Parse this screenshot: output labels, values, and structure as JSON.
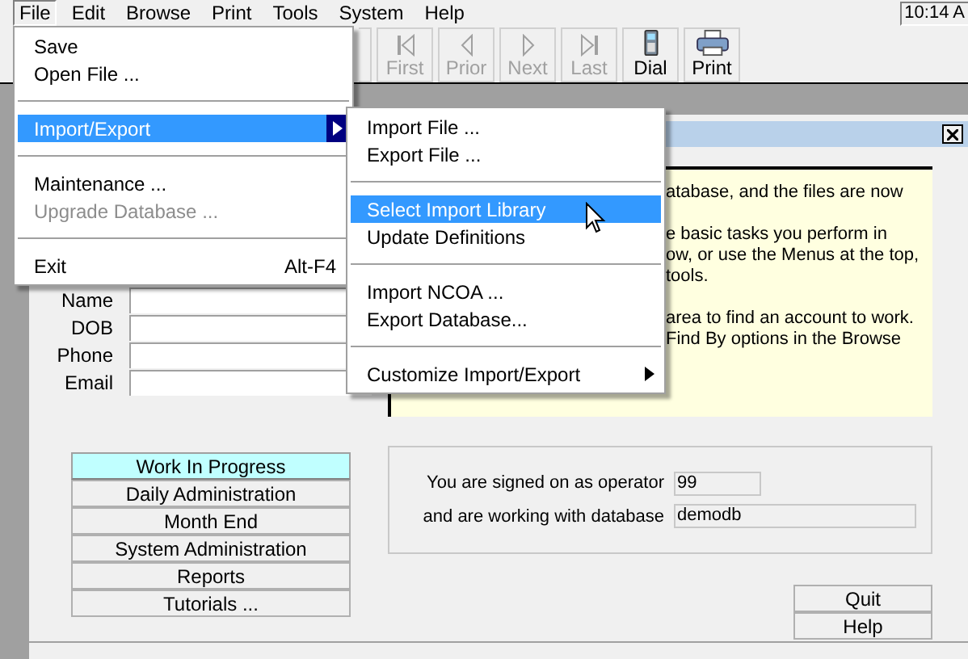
{
  "menu_bar": {
    "items": [
      {
        "label": "File",
        "selected": true
      },
      {
        "label": "Edit",
        "selected": false
      },
      {
        "label": "Browse",
        "selected": false
      },
      {
        "label": "Print",
        "selected": false
      },
      {
        "label": "Tools",
        "selected": false
      },
      {
        "label": "System",
        "selected": false
      },
      {
        "label": "Help",
        "selected": false
      }
    ],
    "clock": "10:14 A"
  },
  "toolbar": [
    {
      "label": "First",
      "disabled": true
    },
    {
      "label": "Prior",
      "disabled": true
    },
    {
      "label": "Next",
      "disabled": true
    },
    {
      "label": "Last",
      "disabled": true
    },
    {
      "label": "Dial",
      "disabled": false
    },
    {
      "label": "Print",
      "disabled": false
    }
  ],
  "file_menu": [
    {
      "kind": "item",
      "label": "Save",
      "selected": false,
      "disabled": false
    },
    {
      "kind": "item",
      "label": "Open File ...",
      "selected": false,
      "disabled": false
    },
    {
      "kind": "separator"
    },
    {
      "kind": "submenu",
      "label": "Import/Export",
      "selected": true,
      "disabled": false
    },
    {
      "kind": "separator"
    },
    {
      "kind": "item",
      "label": "Maintenance ...",
      "selected": false,
      "disabled": false
    },
    {
      "kind": "item",
      "label": "Upgrade Database ...",
      "selected": false,
      "disabled": true
    },
    {
      "kind": "separator"
    },
    {
      "kind": "item",
      "label": "Exit",
      "shortcut": "Alt-F4",
      "selected": false,
      "disabled": false
    }
  ],
  "import_export_submenu": [
    {
      "kind": "item",
      "label": "Import File ...",
      "selected": false,
      "disabled": false
    },
    {
      "kind": "item",
      "label": "Export File ...",
      "selected": false,
      "disabled": false
    },
    {
      "kind": "separator"
    },
    {
      "kind": "item",
      "label": "Select Import Library",
      "selected": true,
      "disabled": false
    },
    {
      "kind": "item",
      "label": "Update Definitions",
      "selected": false,
      "disabled": false
    },
    {
      "kind": "separator"
    },
    {
      "kind": "item",
      "label": "Import NCOA ...",
      "selected": false,
      "disabled": false
    },
    {
      "kind": "item",
      "label": "Export Database...",
      "selected": false,
      "disabled": false
    },
    {
      "kind": "separator"
    },
    {
      "kind": "submenu",
      "label": "Customize Import/Export",
      "selected": false,
      "disabled": false
    }
  ],
  "search_form": [
    {
      "label": "Name"
    },
    {
      "label": "DOB"
    },
    {
      "label": "Phone"
    },
    {
      "label": "Email"
    }
  ],
  "nav_buttons": [
    {
      "label": "Work In Progress",
      "selected": true
    },
    {
      "label": "Daily Administration",
      "selected": false
    },
    {
      "label": "Month End",
      "selected": false
    },
    {
      "label": "System Administration",
      "selected": false
    },
    {
      "label": "Reports",
      "selected": false
    },
    {
      "label": "Tutorials ...",
      "selected": false
    }
  ],
  "info_panel": [
    [
      "atabase, and the files are now"
    ],
    [
      "e basic tasks you perform in",
      "ow, or use the Menus at the top,",
      "tools."
    ],
    [
      "area to find an account to work.",
      "Find By options in the Browse"
    ]
  ],
  "session": {
    "operator_label": "You are signed on as operator",
    "operator": "99",
    "database_label": "and are working with database",
    "database": "demodb"
  },
  "buttons": [
    "Quit",
    "Help"
  ]
}
